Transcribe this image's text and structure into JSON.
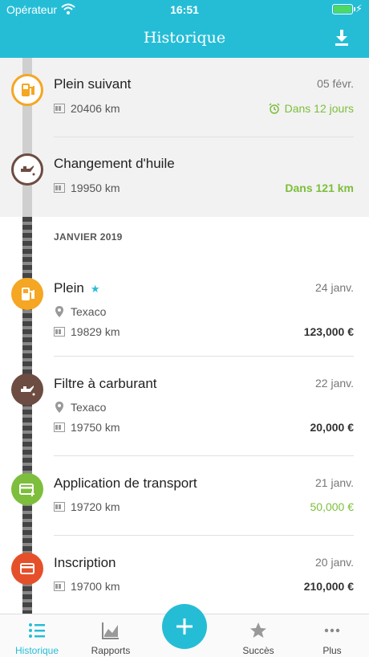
{
  "status": {
    "carrier": "Opérateur",
    "time": "16:51"
  },
  "header": {
    "title": "Historique"
  },
  "upcoming": [
    {
      "title": "Plein suivant",
      "date": "05 févr.",
      "odometer": "20406 km",
      "due": "Dans 12 jours",
      "icon": "fuel-pump-icon",
      "color": "#F5A623"
    },
    {
      "title": "Changement d'huile",
      "odometer": "19950 km",
      "due": "Dans 121 km",
      "icon": "oil-can-icon",
      "color": "#6D4C41"
    }
  ],
  "month_header": "JANVIER 2019",
  "entries": [
    {
      "title": "Plein",
      "date": "24 janv.",
      "location": "Texaco",
      "odometer": "19829 km",
      "amount": "123,000 €",
      "icon": "fuel-pump-icon",
      "color": "#F5A623",
      "starred": true
    },
    {
      "title": "Filtre à carburant",
      "date": "22 janv.",
      "location": "Texaco",
      "odometer": "19750 km",
      "amount": "20,000 €",
      "icon": "oil-can-icon",
      "color": "#6D4C41"
    },
    {
      "title": "Application de transport",
      "date": "21 janv.",
      "odometer": "19720 km",
      "amount": "50,000 €",
      "icon": "card-plus-icon",
      "color": "#7DBE3C",
      "amount_green": true
    },
    {
      "title": "Inscription",
      "date": "20 janv.",
      "odometer": "19700 km",
      "amount": "210,000 €",
      "icon": "card-icon",
      "color": "#E5502A"
    }
  ],
  "tabs": [
    {
      "label": "Historique",
      "icon": "list-icon",
      "active": true
    },
    {
      "label": "Rapports",
      "icon": "chart-icon"
    },
    {
      "label": "Succès",
      "icon": "star-icon"
    },
    {
      "label": "Plus",
      "icon": "more-icon"
    }
  ],
  "colors": {
    "accent": "#25BDD6",
    "green": "#7DBE3C",
    "fuel": "#F5A623",
    "service": "#6D4C41",
    "expense": "#E5502A"
  }
}
